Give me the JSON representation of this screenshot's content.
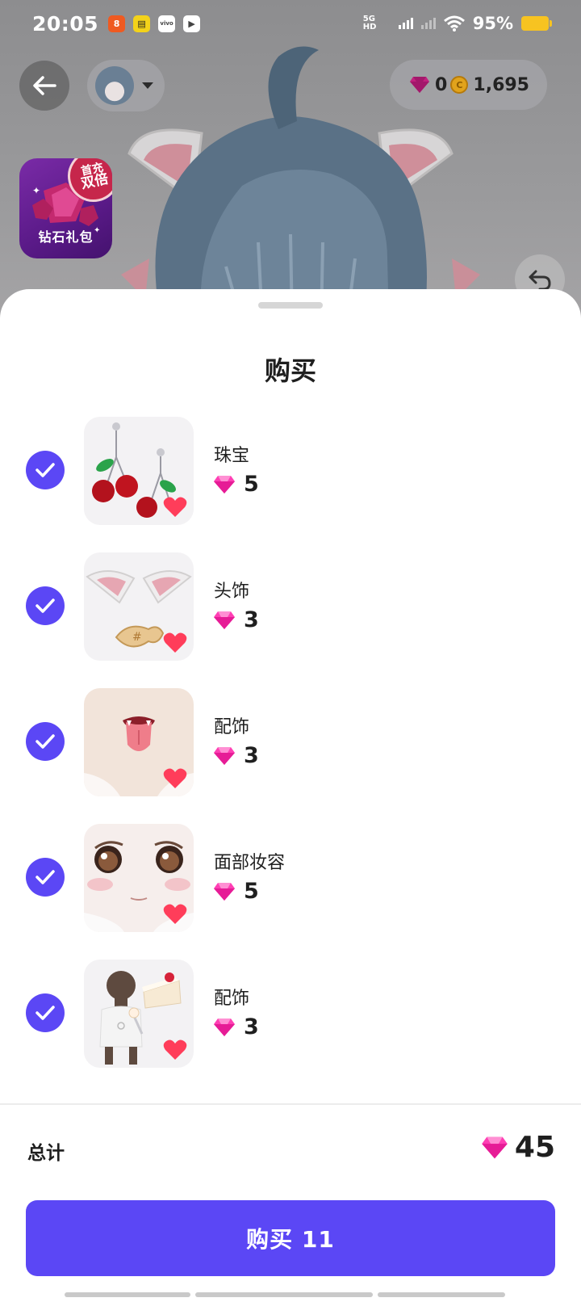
{
  "status_bar": {
    "time": "20:05",
    "network": "5G HD",
    "battery": "95%",
    "notification_icons": [
      "app-icon-orange",
      "app-icon-yellow",
      "vivo-icon",
      "video-icon"
    ]
  },
  "header": {
    "back_icon": "arrow-left-icon",
    "avatar_switch_icon": "chevron-down-icon",
    "diamonds": "0",
    "coins": "1,695"
  },
  "promo": {
    "badge_line1": "首充",
    "badge_line2": "双倍",
    "label": "钻石礼包"
  },
  "sheet": {
    "title": "购买",
    "items": [
      {
        "name": "珠宝",
        "price": "5",
        "thumbnail": "cherry-earrings",
        "checked": true
      },
      {
        "name": "头饰",
        "price": "3",
        "thumbnail": "cat-ears-headwear",
        "checked": true
      },
      {
        "name": "配饰",
        "price": "3",
        "thumbnail": "tongue-accessory",
        "checked": true
      },
      {
        "name": "面部妆容",
        "price": "5",
        "thumbnail": "face-makeup",
        "checked": true
      },
      {
        "name": "配饰",
        "price": "3",
        "thumbnail": "cake-accessory",
        "checked": true
      }
    ],
    "total_label": "总计",
    "total_value": "45",
    "buy_button": "购买 11"
  },
  "colors": {
    "accent": "#5b47f5",
    "diamond": "#ff3fb4",
    "heart": "#ff3d5a",
    "coin": "#e1a31c"
  }
}
